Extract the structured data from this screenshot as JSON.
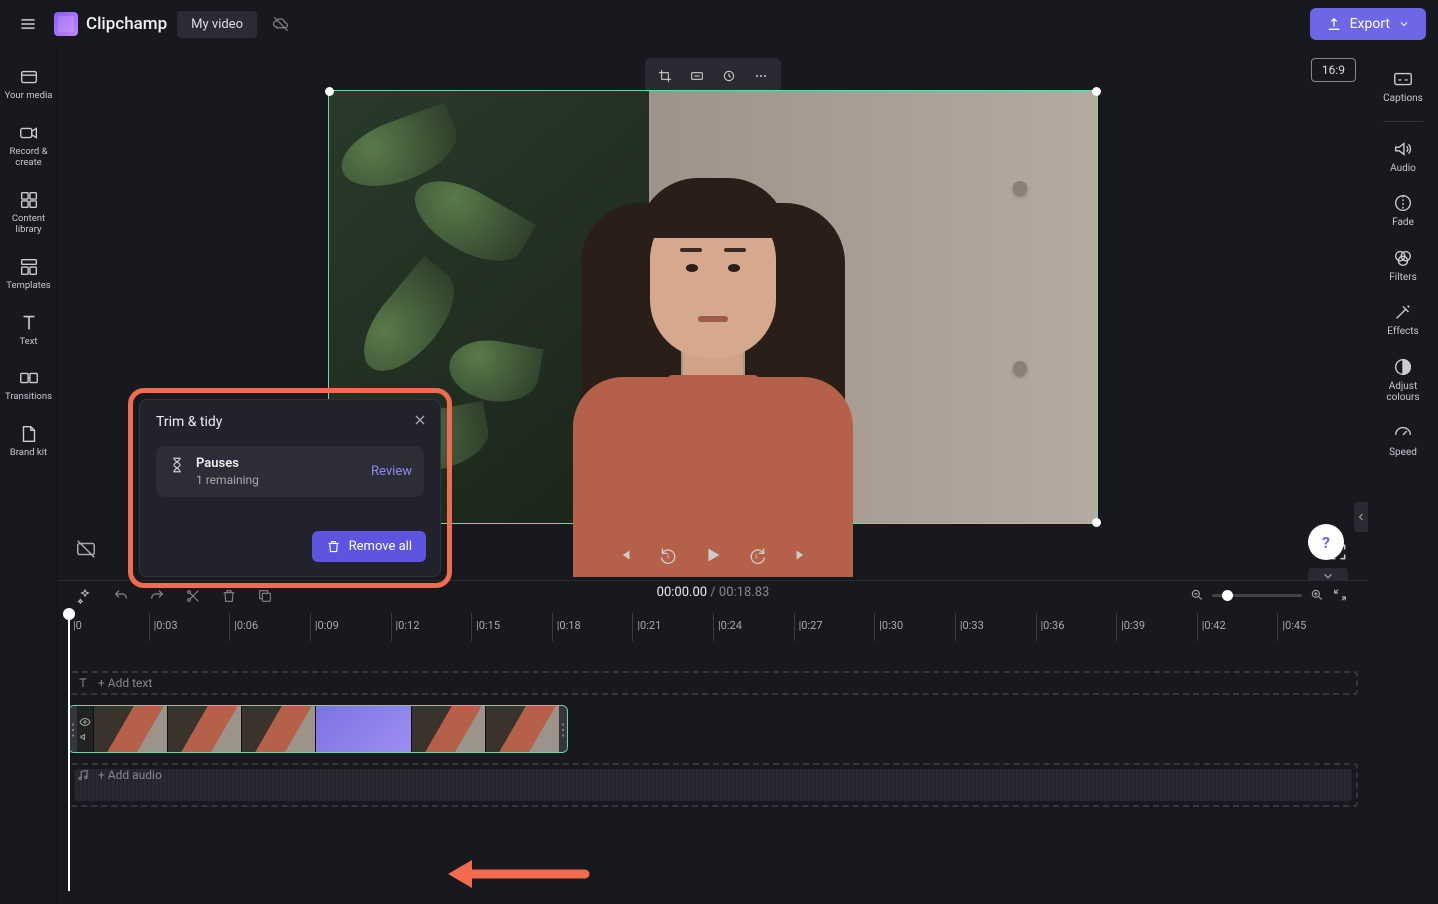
{
  "header": {
    "brand": "Clipchamp",
    "project_name": "My video",
    "export_label": "Export"
  },
  "left_sidebar": [
    {
      "id": "your-media",
      "label": "Your media"
    },
    {
      "id": "record",
      "label": "Record & create"
    },
    {
      "id": "content",
      "label": "Content library"
    },
    {
      "id": "templates",
      "label": "Templates"
    },
    {
      "id": "text",
      "label": "Text"
    },
    {
      "id": "transitions",
      "label": "Transitions"
    },
    {
      "id": "brand",
      "label": "Brand kit"
    }
  ],
  "right_sidebar": [
    {
      "id": "captions",
      "label": "Captions"
    },
    {
      "id": "audio",
      "label": "Audio"
    },
    {
      "id": "fade",
      "label": "Fade"
    },
    {
      "id": "filters",
      "label": "Filters"
    },
    {
      "id": "effects",
      "label": "Effects"
    },
    {
      "id": "adjust",
      "label": "Adjust colours"
    },
    {
      "id": "speed",
      "label": "Speed"
    }
  ],
  "aspect_ratio": "16:9",
  "trim_panel": {
    "title": "Trim & tidy",
    "pause_title": "Pauses",
    "pause_sub": "1 remaining",
    "review_label": "Review",
    "remove_all_label": "Remove all"
  },
  "playback": {
    "current_time": "00:00.00",
    "separator": " / ",
    "total_time": "00:18.83"
  },
  "timeline": {
    "add_text_label": "+ Add text",
    "add_audio_label": "+ Add audio",
    "ruler": [
      "|0",
      "|0:03",
      "|0:06",
      "|0:09",
      "|0:12",
      "|0:15",
      "|0:18",
      "|0:21",
      "|0:24",
      "|0:27",
      "|0:30",
      "|0:33",
      "|0:36",
      "|0:39",
      "|0:42",
      "|0:45"
    ]
  },
  "help_label": "?"
}
